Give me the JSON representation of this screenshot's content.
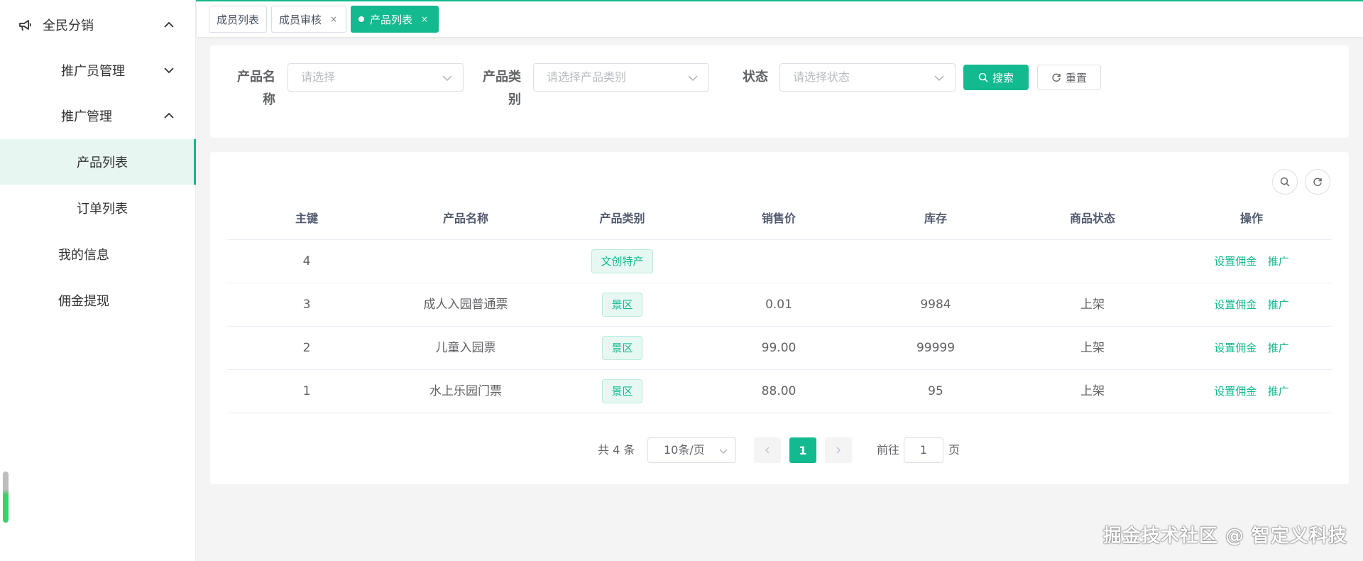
{
  "sidebar": {
    "group_label": "全民分销",
    "items": [
      {
        "label": "推广员管理"
      },
      {
        "label": "推广管理"
      },
      {
        "label": "产品列表"
      },
      {
        "label": "订单列表"
      },
      {
        "label": "我的信息"
      },
      {
        "label": "佣金提现"
      }
    ]
  },
  "tabs": [
    {
      "label": "成员列表"
    },
    {
      "label": "成员审核",
      "close": "×"
    },
    {
      "label": "产品列表",
      "close": "×"
    }
  ],
  "filters": {
    "product_name_label_1": "产品名",
    "product_name_label_2": "称",
    "product_name_placeholder": "请选择",
    "product_type_label_1": "产品类",
    "product_type_label_2": "别",
    "product_type_placeholder": "请选择产品类别",
    "status_label": "状态",
    "status_placeholder": "请选择状态",
    "search_label": "搜索",
    "reset_label": "重置"
  },
  "table": {
    "headers": [
      "主键",
      "产品名称",
      "产品类别",
      "销售价",
      "库存",
      "商品状态",
      "操作"
    ],
    "rows": [
      {
        "id": "4",
        "name": "",
        "type": "文创特产",
        "price": "",
        "stock": "",
        "status": "",
        "act1": "设置佣金",
        "act2": "推广"
      },
      {
        "id": "3",
        "name": "成人入园普通票",
        "type": "景区",
        "price": "0.01",
        "stock": "9984",
        "status": "上架",
        "act1": "设置佣金",
        "act2": "推广"
      },
      {
        "id": "2",
        "name": "儿童入园票",
        "type": "景区",
        "price": "99.00",
        "stock": "99999",
        "status": "上架",
        "act1": "设置佣金",
        "act2": "推广"
      },
      {
        "id": "1",
        "name": "水上乐园门票",
        "type": "景区",
        "price": "88.00",
        "stock": "95",
        "status": "上架",
        "act1": "设置佣金",
        "act2": "推广"
      }
    ]
  },
  "pagination": {
    "total": "共 4 条",
    "page_size": "10条/页",
    "current": "1",
    "goto_prefix": "前往",
    "goto_value": "1",
    "goto_suffix": "页"
  },
  "watermark": "掘金技术社区 @ 智定义科技",
  "colors": {
    "accent": "#13b98f"
  }
}
